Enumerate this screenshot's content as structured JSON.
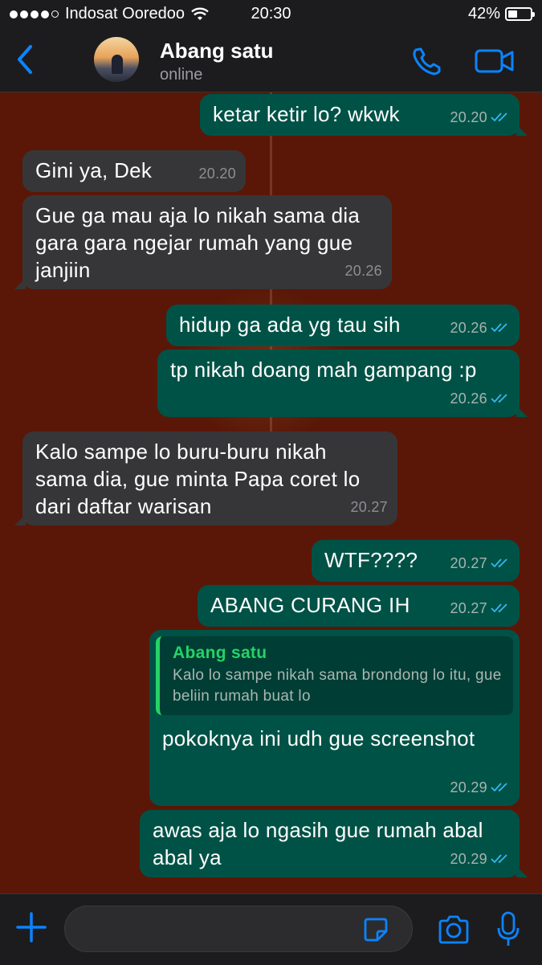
{
  "status_bar": {
    "carrier": "Indosat Ooredoo",
    "time": "20:30",
    "battery": "42%",
    "battery_level": 0.42
  },
  "header": {
    "contact_name": "Abang satu",
    "contact_status": "online"
  },
  "messages": [
    {
      "direction": "out",
      "text": "ketar ketir lo? wkwk",
      "time": "20.20",
      "read": true
    },
    {
      "direction": "in",
      "text": "Gini ya, Dek",
      "time": "20.20"
    },
    {
      "direction": "in",
      "text": "Gue ga mau aja lo nikah sama dia gara gara ngejar rumah yang gue janjiin",
      "time": "20.26"
    },
    {
      "direction": "out",
      "text": "hidup ga ada yg tau sih",
      "time": "20.26",
      "read": true
    },
    {
      "direction": "out",
      "text": "tp nikah doang mah gampang :p",
      "time": "20.26",
      "read": true
    },
    {
      "direction": "in",
      "text": "Kalo sampe lo buru-buru nikah sama dia, gue minta Papa coret lo dari daftar warisan",
      "time": "20.27"
    },
    {
      "direction": "out",
      "text": "WTF????",
      "time": "20.27",
      "read": true
    },
    {
      "direction": "out",
      "text": "ABANG CURANG IH",
      "time": "20.27",
      "read": true
    },
    {
      "direction": "out",
      "text": "pokoknya ini udh gue screenshot",
      "time": "20.29",
      "read": true,
      "quote": {
        "author": "Abang satu",
        "text": "Kalo lo sampe nikah sama brondong lo itu, gue beliin rumah buat lo"
      }
    },
    {
      "direction": "out",
      "text": "awas aja lo ngasih gue rumah abal abal ya",
      "time": "20.29",
      "read": true
    }
  ],
  "colors": {
    "outgoing": "#005246",
    "incoming": "#363638",
    "accent": "#0a84ff",
    "wallpaper": "#5a1707",
    "read_ticks": "#34b7f1"
  },
  "icons": [
    "back-chevron-icon",
    "phone-icon",
    "video-camera-icon",
    "plus-icon",
    "sticker-icon",
    "camera-icon",
    "microphone-icon"
  ]
}
